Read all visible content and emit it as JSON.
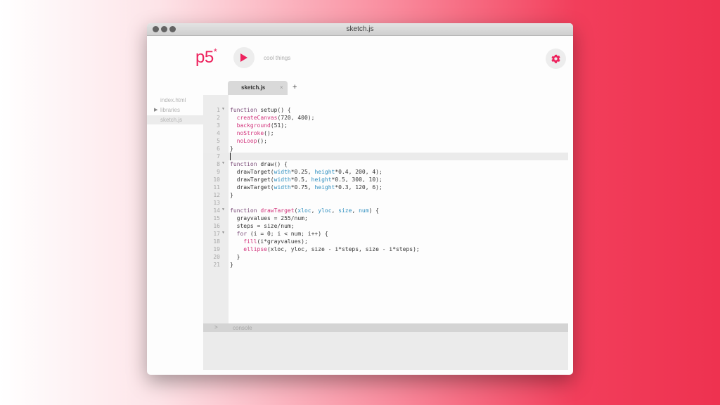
{
  "window": {
    "title": "sketch.js"
  },
  "header": {
    "logo_text": "p5",
    "logo_star": "*",
    "sketch_name": "cool things"
  },
  "icons": {
    "play": "play-icon",
    "settings": "gear-icon",
    "folder": "folder-icon"
  },
  "colors": {
    "accent": "#ed225d",
    "keyword": "#7a4b78",
    "p5_function": "#d2317a",
    "constant": "#2f8fc0"
  },
  "tabs": {
    "active_label": "sketch.js",
    "close_glyph": "×",
    "add_glyph": "+"
  },
  "sidebar": {
    "items": [
      {
        "label": "index.html"
      },
      {
        "label": "libraries",
        "arrow": "▶"
      },
      {
        "label": "sketch.js"
      }
    ]
  },
  "editor": {
    "current_line": 7,
    "lines": [
      {
        "n": "1",
        "fold": "▼",
        "code": "<span class='k'>function</span> setup() {"
      },
      {
        "n": "2",
        "code": "  <span class='p5'>createCanvas</span>(720, 400);"
      },
      {
        "n": "3",
        "code": "  <span class='p5'>background</span>(51);"
      },
      {
        "n": "4",
        "code": "  <span class='p5'>noStroke</span>();"
      },
      {
        "n": "5",
        "code": "  <span class='p5'>noLoop</span>();"
      },
      {
        "n": "6",
        "code": "}"
      },
      {
        "n": "7",
        "code": ""
      },
      {
        "n": "8",
        "fold": "▼",
        "code": "<span class='k'>function</span> draw() {"
      },
      {
        "n": "9",
        "code": "  drawTarget(<span class='c'>width</span>*0.25, <span class='c'>height</span>*0.4, 200, 4);"
      },
      {
        "n": "10",
        "code": "  drawTarget(<span class='c'>width</span>*0.5, <span class='c'>height</span>*0.5, 300, 10);"
      },
      {
        "n": "11",
        "code": "  drawTarget(<span class='c'>width</span>*0.75, <span class='c'>height</span>*0.3, 120, 6);"
      },
      {
        "n": "12",
        "code": "}"
      },
      {
        "n": "13",
        "code": ""
      },
      {
        "n": "14",
        "fold": "▼",
        "code": "<span class='k'>function</span> <span class='p5'>drawTarget</span>(<span class='c'>xloc</span>, <span class='c'>yloc</span>, <span class='c'>size</span>, <span class='c'>num</span>) {"
      },
      {
        "n": "15",
        "code": "  grayvalues = 255/num;"
      },
      {
        "n": "16",
        "code": "  steps = size/num;"
      },
      {
        "n": "17",
        "fold": "▼",
        "code": "  <span class='k'>for</span> (i = 0; i &lt; num; i++) {"
      },
      {
        "n": "18",
        "code": "    <span class='p5'>fill</span>(i*grayvalues);"
      },
      {
        "n": "19",
        "code": "    <span class='p5'>ellipse</span>(xloc, yloc, size - i*steps, size - i*steps);"
      },
      {
        "n": "20",
        "code": "  }"
      },
      {
        "n": "21",
        "code": "}"
      }
    ]
  },
  "console": {
    "chevron": ">",
    "label": "console"
  }
}
